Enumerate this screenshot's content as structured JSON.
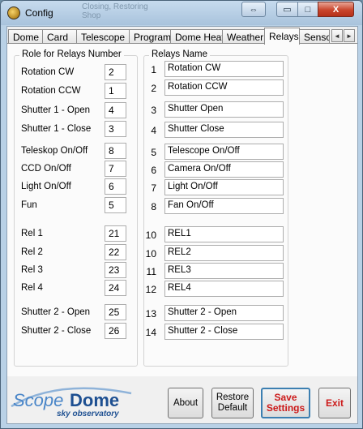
{
  "window": {
    "title": "Config",
    "ghost_text": [
      "Closing, Restoring",
      "Shop"
    ]
  },
  "title_buttons": {
    "swap": "⇔",
    "minimize": "▭",
    "maximize": "□",
    "close": "X"
  },
  "tabs": [
    {
      "label": "Dome"
    },
    {
      "label": "Card"
    },
    {
      "label": "Telescope"
    },
    {
      "label": "Program"
    },
    {
      "label": "Dome Heat"
    },
    {
      "label": "Weather"
    },
    {
      "label": "Relays"
    },
    {
      "label": "Senso"
    }
  ],
  "active_tab": "Relays",
  "tab_scroll": {
    "left": "◄",
    "right": "►"
  },
  "roles": {
    "title": "Role for Relays Number",
    "items": [
      {
        "label": "Rotation CW",
        "value": "2"
      },
      {
        "label": "Rotation CCW",
        "value": "1"
      },
      {
        "label": "Shutter 1 - Open",
        "value": "4"
      },
      {
        "label": "Shutter 1 - Close",
        "value": "3"
      },
      {
        "label": "Teleskop On/Off",
        "value": "8"
      },
      {
        "label": "CCD On/Off",
        "value": "7"
      },
      {
        "label": "Light On/Off",
        "value": "6"
      },
      {
        "label": "Fun",
        "value": "5"
      },
      {
        "label": "Rel 1",
        "value": "21"
      },
      {
        "label": "Rel 2",
        "value": "22"
      },
      {
        "label": "Rel 3",
        "value": "23"
      },
      {
        "label": "Rel 4",
        "value": "24"
      },
      {
        "label": "Shutter 2 - Open",
        "value": "25"
      },
      {
        "label": "Shutter 2 - Close",
        "value": "26"
      }
    ]
  },
  "relays": {
    "title": "Relays Name",
    "items": [
      {
        "num": "1",
        "name": "Rotation CW"
      },
      {
        "num": "2",
        "name": "Rotation CCW"
      },
      {
        "num": "3",
        "name": "Shutter Open"
      },
      {
        "num": "4",
        "name": "Shutter Close"
      },
      {
        "num": "5",
        "name": "Telescope On/Off"
      },
      {
        "num": "6",
        "name": "Camera On/Off"
      },
      {
        "num": "7",
        "name": "Light On/Off"
      },
      {
        "num": "8",
        "name": "Fan On/Off"
      },
      {
        "num": "10",
        "name": "REL1"
      },
      {
        "num": "10",
        "name": "REL2"
      },
      {
        "num": "11",
        "name": "REL3"
      },
      {
        "num": "12",
        "name": "REL4"
      },
      {
        "num": "13",
        "name": "Shutter 2 - Open"
      },
      {
        "num": "14",
        "name": "Shutter 2 - Close"
      }
    ]
  },
  "logo": {
    "brand_a": "Scope",
    "brand_b": "Dome",
    "tagline": "sky observatory"
  },
  "buttons": {
    "about": "About",
    "restore_line1": "Restore",
    "restore_line2": "Default",
    "save_line1": "Save",
    "save_line2": "Settings",
    "exit": "Exit"
  }
}
